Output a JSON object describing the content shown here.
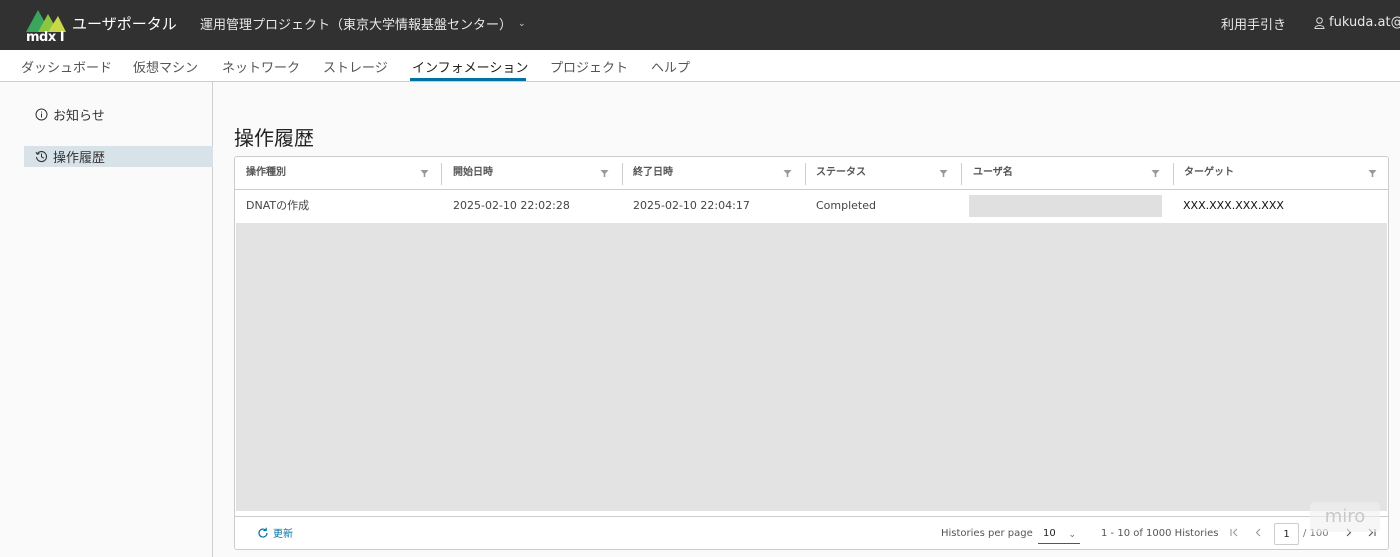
{
  "header": {
    "app_title": "ユーザポータル",
    "logo_text": "mdx I",
    "project": "運用管理プロジェクト（東京大学情報基盤センター）",
    "manual": "利用手引き",
    "user": "fukuda.at@"
  },
  "nav": {
    "tabs": [
      {
        "label": "ダッシュボード"
      },
      {
        "label": "仮想マシン"
      },
      {
        "label": "ネットワーク"
      },
      {
        "label": "ストレージ"
      },
      {
        "label": "インフォメーション"
      },
      {
        "label": "プロジェクト"
      },
      {
        "label": "ヘルプ"
      }
    ],
    "active_tab": "インフォメーション"
  },
  "sidebar": {
    "items": [
      {
        "label": "お知らせ",
        "icon": "info-circle-icon"
      },
      {
        "label": "操作履歴",
        "icon": "history-icon"
      }
    ],
    "active_item": "操作履歴"
  },
  "page": {
    "title": "操作履歴"
  },
  "table": {
    "columns": [
      "操作種別",
      "開始日時",
      "終了日時",
      "ステータス",
      "ユーザ名",
      "ターゲット"
    ],
    "rows": [
      {
        "type": "DNATの作成",
        "start": "2025-02-10 22:02:28",
        "end": "2025-02-10 22:04:17",
        "status": "Completed",
        "user": "",
        "target": "XXX.XXX.XXX.XXX"
      }
    ]
  },
  "footer": {
    "refresh": "更新",
    "per_page_label": "Histories per page",
    "per_page_value": "10",
    "range": "1 - 10 of 1000 Histories",
    "current_page": "1",
    "total_pages": "/ 100"
  },
  "watermark": "miro",
  "colors": {
    "header_bg": "#313131",
    "accent": "#0072a3",
    "active_side_bg": "#d8e3e9"
  }
}
